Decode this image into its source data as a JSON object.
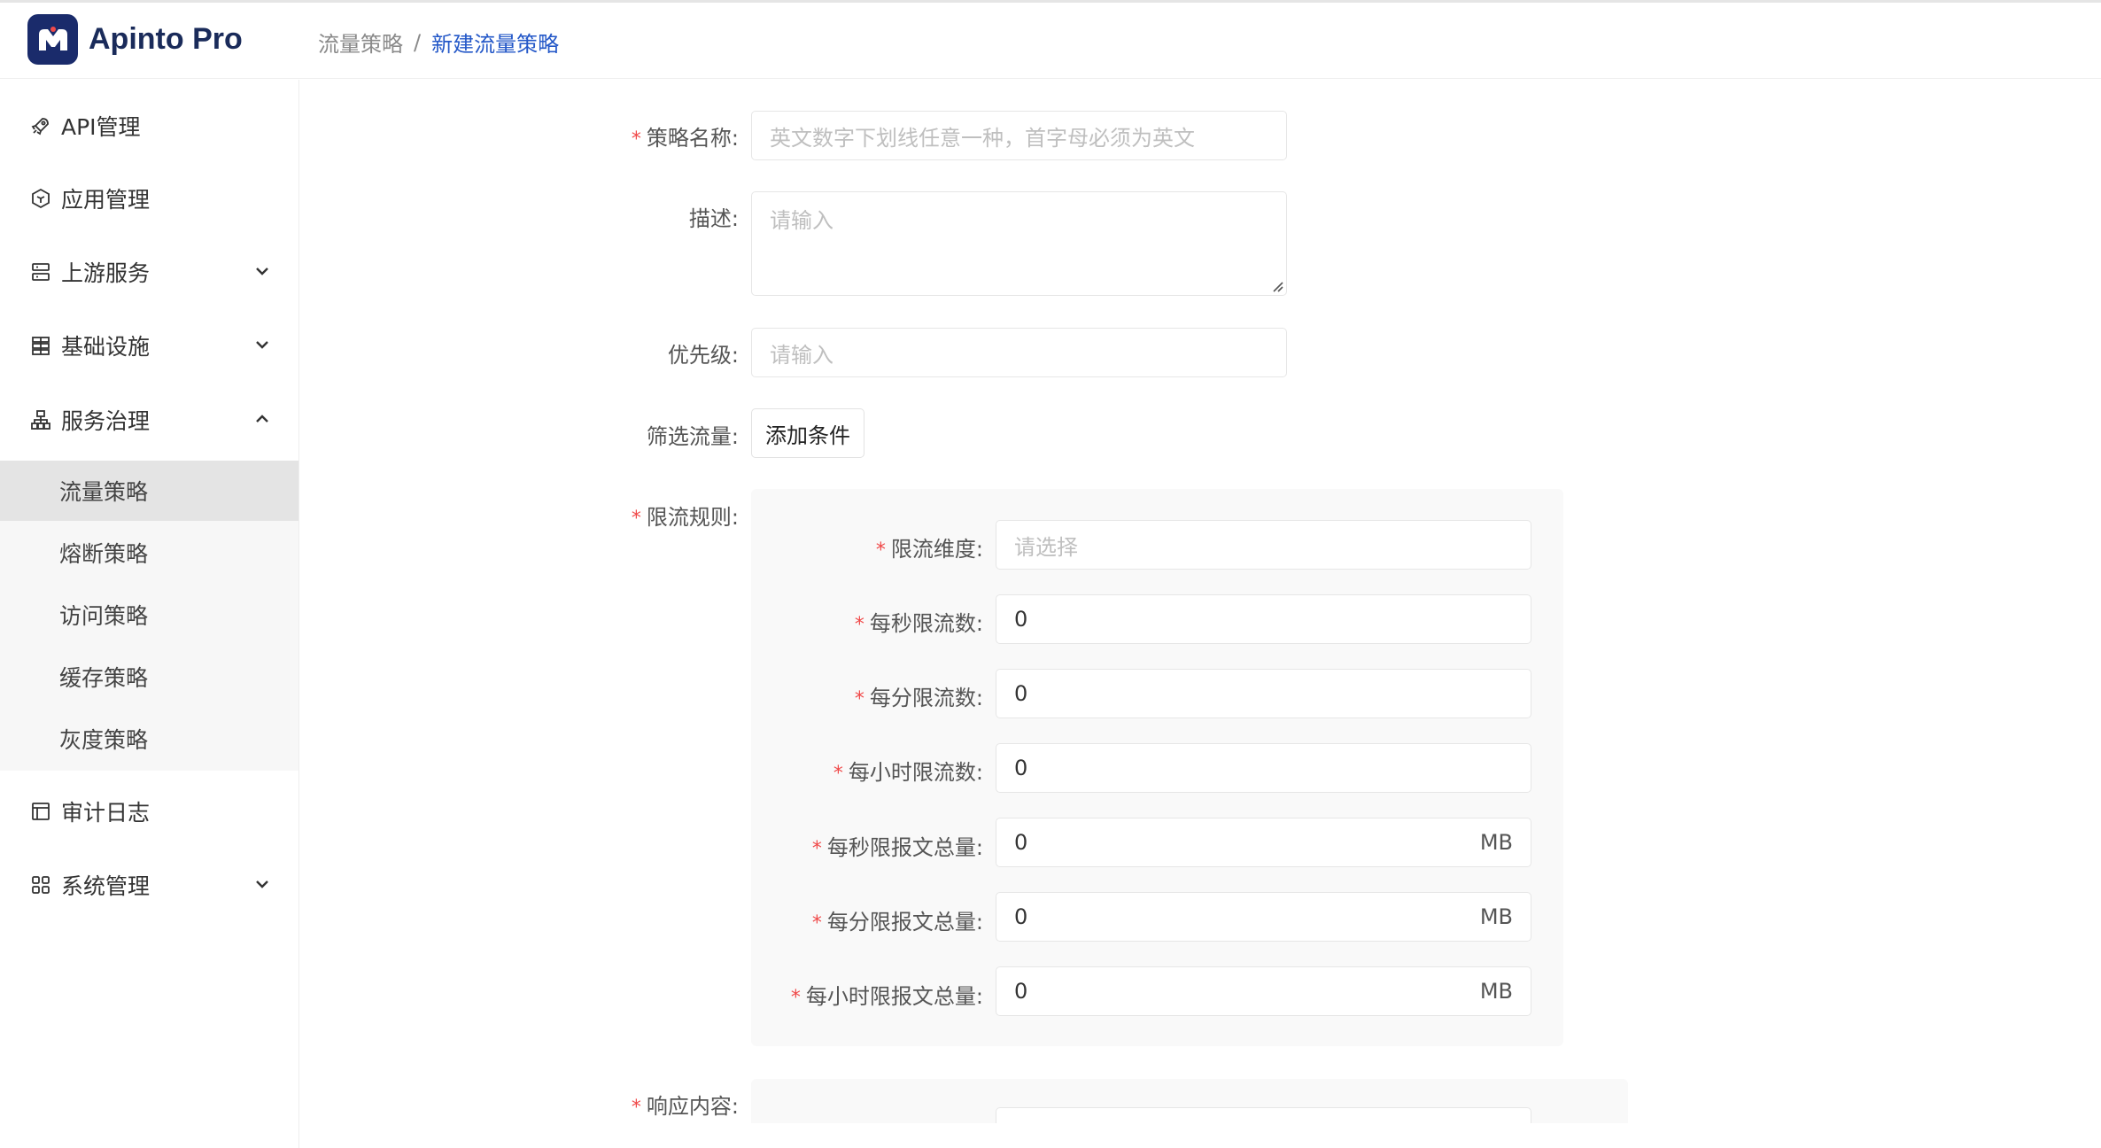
{
  "app": {
    "name": "Apinto Pro"
  },
  "breadcrumb": {
    "parent": "流量策略",
    "separator": "/",
    "current": "新建流量策略"
  },
  "sidebar": {
    "items": [
      {
        "label": "API管理",
        "icon": "rocket-icon"
      },
      {
        "label": "应用管理",
        "icon": "cube-icon"
      },
      {
        "label": "上游服务",
        "icon": "server-icon"
      },
      {
        "label": "基础设施",
        "icon": "database-icon"
      },
      {
        "label": "服务治理",
        "icon": "sitemap-icon"
      },
      {
        "label": "审计日志",
        "icon": "table-icon"
      },
      {
        "label": "系统管理",
        "icon": "grid-icon"
      }
    ],
    "submenu": [
      {
        "label": "流量策略",
        "active": true
      },
      {
        "label": "熔断策略"
      },
      {
        "label": "访问策略"
      },
      {
        "label": "缓存策略"
      },
      {
        "label": "灰度策略"
      }
    ]
  },
  "form": {
    "name": {
      "label": "策略名称:",
      "placeholder": "英文数字下划线任意一种，首字母必须为英文"
    },
    "desc": {
      "label": "描述:",
      "placeholder": "请输入"
    },
    "priority": {
      "label": "优先级:",
      "placeholder": "请输入"
    },
    "filter": {
      "label": "筛选流量:",
      "button": "添加条件"
    },
    "limit_rules": {
      "label": "限流规则:",
      "dimension": {
        "label": "限流维度:",
        "placeholder": "请选择"
      },
      "per_second": {
        "label": "每秒限流数:",
        "value": "0"
      },
      "per_minute": {
        "label": "每分限流数:",
        "value": "0"
      },
      "per_hour": {
        "label": "每小时限流数:",
        "value": "0"
      },
      "bytes_second": {
        "label": "每秒限报文总量:",
        "value": "0",
        "unit": "MB"
      },
      "bytes_minute": {
        "label": "每分限报文总量:",
        "value": "0",
        "unit": "MB"
      },
      "bytes_hour": {
        "label": "每小时限报文总量:",
        "value": "0",
        "unit": "MB"
      }
    },
    "response": {
      "label": "响应内容:"
    }
  },
  "colors": {
    "brand": "#1a2b6b",
    "link": "#2458c8",
    "required": "#f04a4a"
  }
}
